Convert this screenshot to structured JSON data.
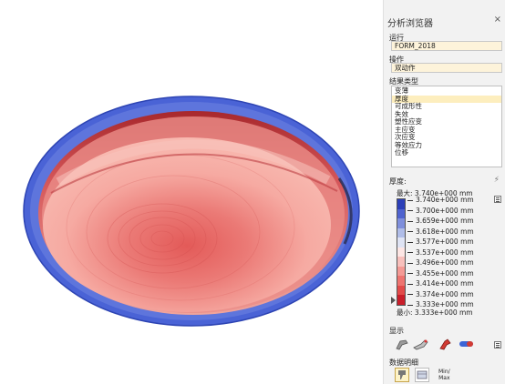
{
  "panel": {
    "title": "分析浏览器",
    "close_glyph": "×",
    "run": {
      "label": "运行",
      "value": "FORM_2018"
    },
    "operation": {
      "label": "操作",
      "value": "双动作"
    },
    "result_type": {
      "label": "结果类型",
      "items": [
        "变薄",
        "厚度",
        "可成形性",
        "失效",
        "塑性应变",
        "主应变",
        "次应变",
        "等效应力",
        "位移"
      ],
      "selected_index": 1
    },
    "legend": {
      "title": "厚度:",
      "max_label": "最大:",
      "max_value": "3.740e+000 mm",
      "min_label": "最小:",
      "min_value": "3.333e+000 mm",
      "ticks": [
        "3.740e+000 mm",
        "3.700e+000 mm",
        "3.659e+000 mm",
        "3.618e+000 mm",
        "3.577e+000 mm",
        "3.537e+000 mm",
        "3.496e+000 mm",
        "3.455e+000 mm",
        "3.414e+000 mm",
        "3.374e+000 mm",
        "3.333e+000 mm"
      ],
      "colors": [
        "#2b3fb8",
        "#4f63cf",
        "#7f8fdc",
        "#b0bde8",
        "#dfe4f4",
        "#fde6e4",
        "#f8c0bc",
        "#f49a95",
        "#ee7470",
        "#e24b4a",
        "#c91e2a"
      ]
    },
    "display": {
      "label": "显示"
    },
    "data_detail": {
      "label": "数据明细",
      "minmax_line1": "Min/",
      "minmax_line2": "Max"
    }
  }
}
